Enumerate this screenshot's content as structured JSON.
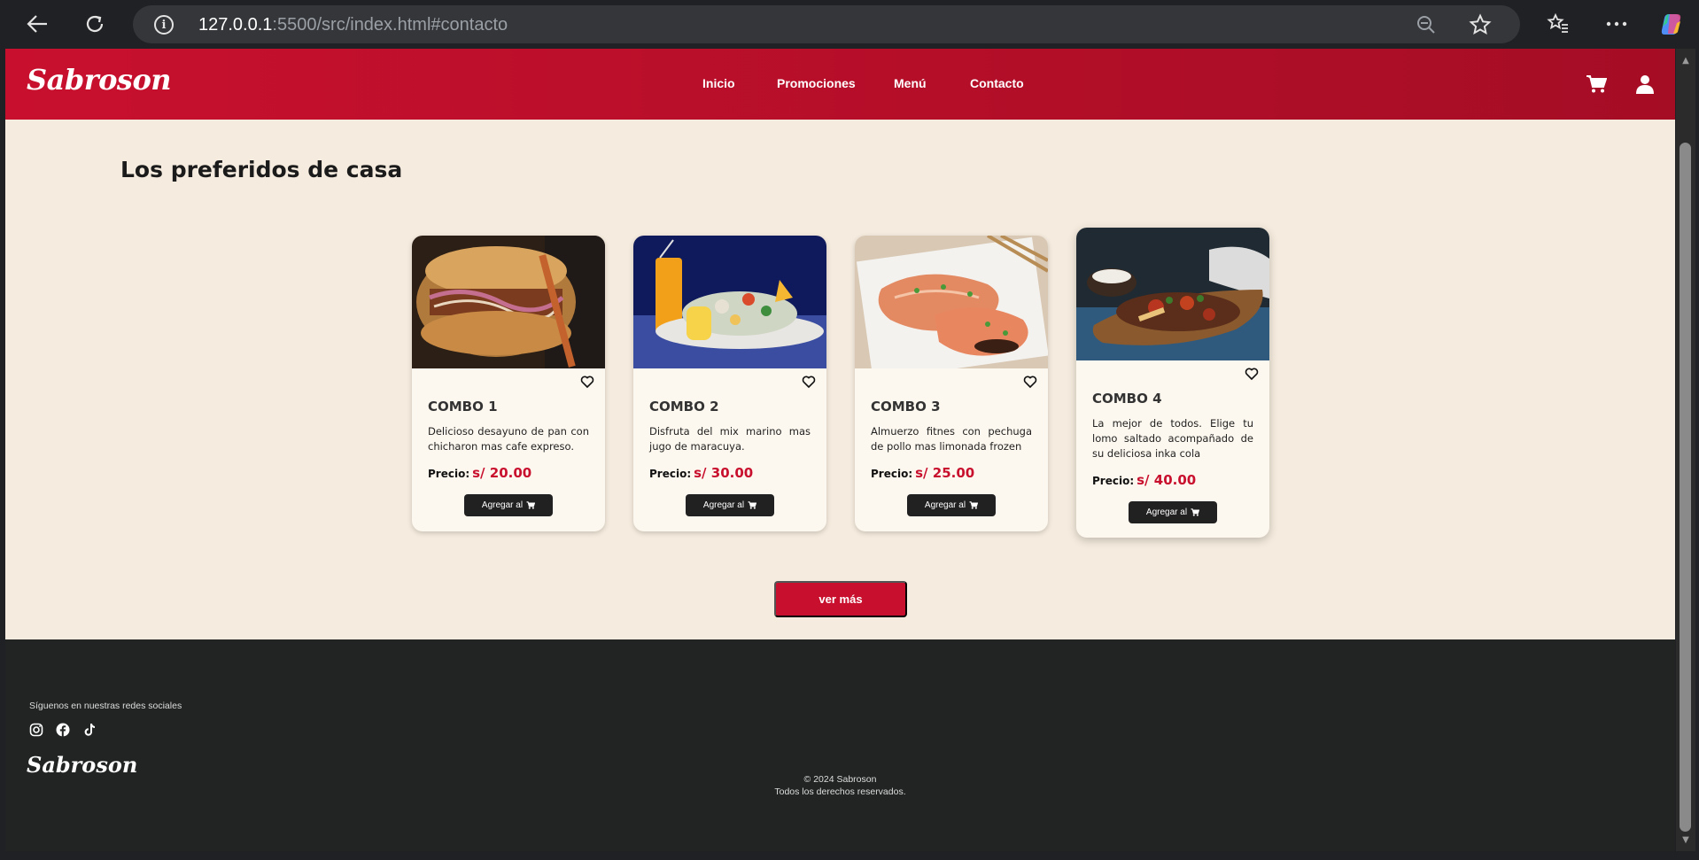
{
  "browser": {
    "url_host": "127.0.0.1",
    "url_rest": ":5500/src/index.html#contacto"
  },
  "header": {
    "logo": "Sabroson",
    "nav": [
      "Inicio",
      "Promociones",
      "Menú",
      "Contacto"
    ]
  },
  "section": {
    "title": "Los preferidos de casa",
    "more_button": "ver más"
  },
  "cards": [
    {
      "title": "COMBO 1",
      "desc": "Delicioso desayuno de pan con chicharon mas cafe expreso.",
      "price_label": "Precio:",
      "price": "s/ 20.00",
      "button": "Agregar al"
    },
    {
      "title": "COMBO 2",
      "desc": "Disfruta del mix marino mas jugo de maracuya.",
      "price_label": "Precio:",
      "price": "s/ 30.00",
      "button": "Agregar al"
    },
    {
      "title": "COMBO 3",
      "desc": "Almuerzo fitnes con pechuga de pollo mas limonada frozen",
      "price_label": "Precio:",
      "price": "s/ 25.00",
      "button": "Agregar al"
    },
    {
      "title": "COMBO 4",
      "desc": "La mejor de todos. Elige tu lomo saltado acompañado de su deliciosa inka cola",
      "price_label": "Precio:",
      "price": "s/ 40.00",
      "button": "Agregar al"
    }
  ],
  "footer": {
    "follow": "Síguenos en nuestras redes sociales",
    "logo": "Sabroson",
    "copyright": "© 2024 Sabroson",
    "rights": "Todos los derechos reservados."
  },
  "colors": {
    "brand_red": "#c8102e",
    "cream": "#f5ebde",
    "footer": "#222424"
  }
}
